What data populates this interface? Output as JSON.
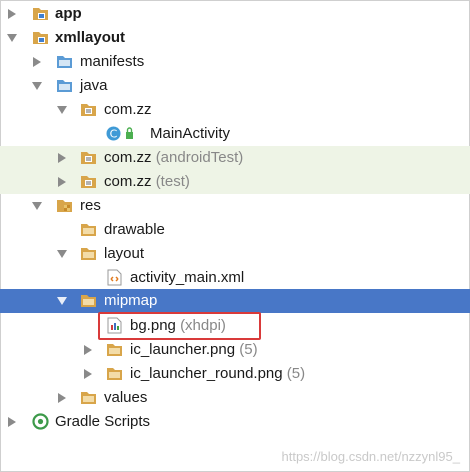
{
  "tree": {
    "rows": [
      {
        "label": "app",
        "bold": true
      },
      {
        "label": "xmllayout",
        "bold": true
      },
      {
        "label": "manifests"
      },
      {
        "label": "java"
      },
      {
        "label": "com.zz"
      },
      {
        "label": "MainActivity"
      },
      {
        "label": "com.zz",
        "suffix": "(androidTest)"
      },
      {
        "label": "com.zz",
        "suffix": "(test)"
      },
      {
        "label": "res"
      },
      {
        "label": "drawable"
      },
      {
        "label": "layout"
      },
      {
        "label": "activity_main.xml"
      },
      {
        "label": "mipmap",
        "selected": true
      },
      {
        "label": "bg.png",
        "suffix": "(xhdpi)",
        "highlighted": true
      },
      {
        "label": "ic_launcher.png",
        "suffix": "(5)"
      },
      {
        "label": "ic_launcher_round.png",
        "suffix": "(5)"
      },
      {
        "label": "values"
      },
      {
        "label": "Gradle Scripts"
      }
    ]
  },
  "watermark": "https://blog.csdn.net/nzzynl95_",
  "colors": {
    "selection": "#4877c7",
    "alt_row": "#eef4e6",
    "highlight_border": "#d93a3a",
    "folder": "#d8a54a",
    "module_folder_accent": "#3f7fd0"
  }
}
